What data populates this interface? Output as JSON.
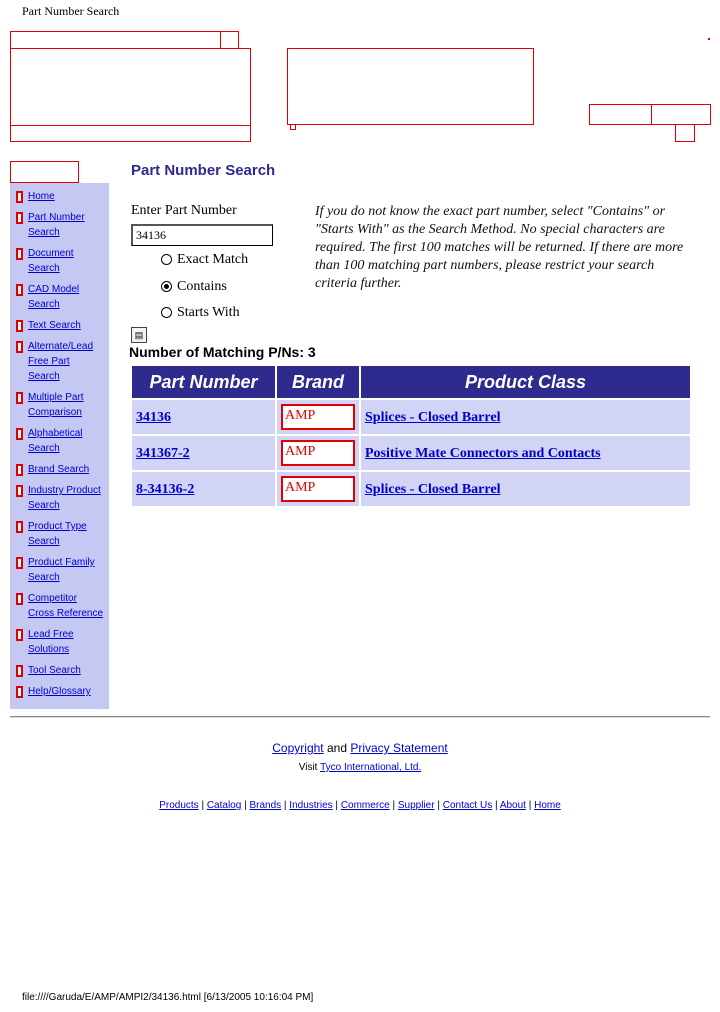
{
  "page_header": "Part Number Search",
  "sidebar": {
    "items": [
      {
        "label": "Home"
      },
      {
        "label": "Part Number Search"
      },
      {
        "label": "Document Search"
      },
      {
        "label": "CAD Model Search"
      },
      {
        "label": "Text Search"
      },
      {
        "label": "Alternate/Lead Free Part Search"
      },
      {
        "label": "Multiple Part Comparison"
      },
      {
        "label": "Alphabetical Search"
      },
      {
        "label": "Brand Search"
      },
      {
        "label": "Industry Product Search"
      },
      {
        "label": "Product Type Search"
      },
      {
        "label": "Product Family Search"
      },
      {
        "label": "Competitor Cross Reference"
      },
      {
        "label": "Lead Free Solutions"
      },
      {
        "label": "Tool Search"
      },
      {
        "label": "Help/Glossary"
      }
    ]
  },
  "main": {
    "title": "Part Number Search",
    "input_label": "Enter Part Number",
    "input_value": "34136",
    "options": [
      "Exact Match",
      "Contains",
      "Starts With"
    ],
    "selected_option": "Contains",
    "help_text": "If you do not know the exact part number, select \"Contains\" or \"Starts With\" as the Search Method. No special characters are required. The first 100 matches will be returned. If there are more than 100 matching part numbers, please restrict your search criteria further.",
    "matching_label": "Number of Matching P/Ns: 3"
  },
  "results": {
    "headers": [
      "Part Number",
      "Brand",
      "Product Class"
    ],
    "rows": [
      {
        "part_number": "34136",
        "brand": "AMP",
        "product_class": "Splices - Closed Barrel"
      },
      {
        "part_number": "341367-2",
        "brand": "AMP",
        "product_class": "Positive Mate Connectors and Contacts"
      },
      {
        "part_number": "8-34136-2",
        "brand": "AMP",
        "product_class": "Splices - Closed Barrel"
      }
    ]
  },
  "footer": {
    "copyright": "Copyright",
    "and": "and",
    "privacy": "Privacy Statement",
    "visit": "Visit",
    "tyco": "Tyco International, Ltd.",
    "links": [
      "Products",
      "Catalog",
      "Brands",
      "Industries",
      "Commerce",
      "Supplier",
      "Contact Us",
      "About",
      "Home"
    ],
    "file_path": "file:////Garuda/E/AMP/AMPI2/34136.html [6/13/2005 10:16:04 PM]"
  },
  "colors": {
    "nav_bg": "#c6c8f4",
    "header_bg": "#2e2a8e",
    "row_bg": "#d2d4f6",
    "link": "#0000cc",
    "placeholder_border": "#e00000"
  }
}
